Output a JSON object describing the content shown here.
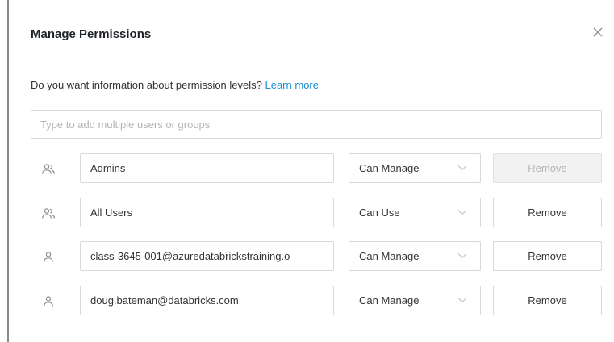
{
  "dialog": {
    "title": "Manage Permissions",
    "close_icon": "close-icon"
  },
  "info": {
    "question": "Do you want information about permission levels? ",
    "link": "Learn more"
  },
  "search": {
    "placeholder": "Type to add multiple users or groups",
    "value": ""
  },
  "permissions": [
    {
      "principal_type": "group",
      "icon": "group-icon",
      "name": "Admins",
      "level": "Can Manage",
      "remove_label": "Remove",
      "remove_disabled": true
    },
    {
      "principal_type": "group",
      "icon": "group-icon",
      "name": "All Users",
      "level": "Can Use",
      "remove_label": "Remove",
      "remove_disabled": false
    },
    {
      "principal_type": "user",
      "icon": "user-icon",
      "name": "class-3645-001@azuredatabrickstraining.o",
      "level": "Can Manage",
      "remove_label": "Remove",
      "remove_disabled": false
    },
    {
      "principal_type": "user",
      "icon": "user-icon",
      "name": "doug.bateman@databricks.com",
      "level": "Can Manage",
      "remove_label": "Remove",
      "remove_disabled": false
    }
  ],
  "colors": {
    "link": "#1a8fd6",
    "border": "#d9d9d9",
    "disabled_bg": "#f2f2f2"
  }
}
